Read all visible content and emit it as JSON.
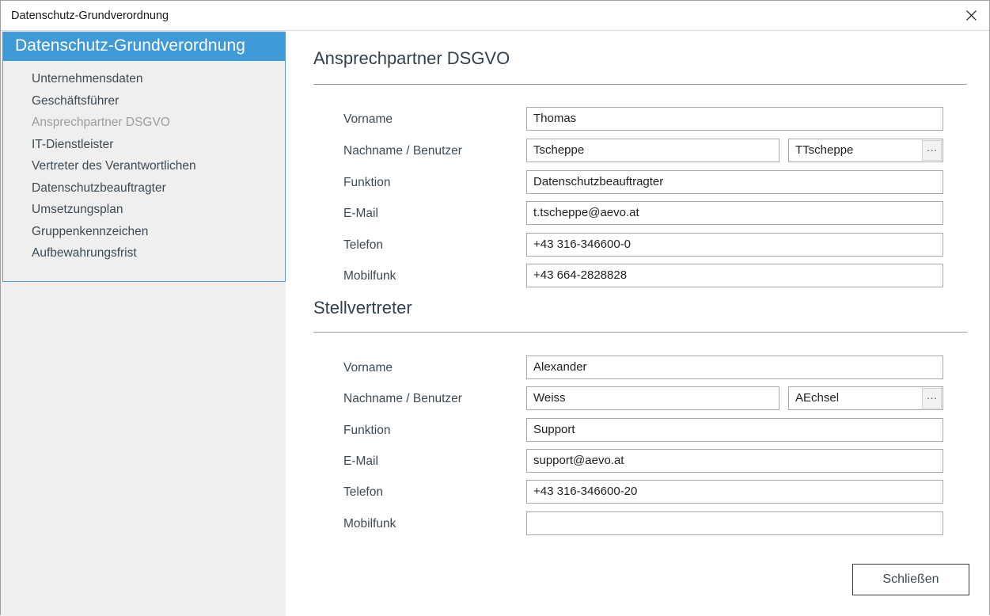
{
  "window": {
    "title": "Datenschutz-Grundverordnung",
    "close_icon": "close-icon"
  },
  "sidebar": {
    "header": "Datenschutz-Grundverordnung",
    "items": [
      {
        "label": "Unternehmensdaten",
        "active": false
      },
      {
        "label": "Geschäftsführer",
        "active": false
      },
      {
        "label": "Ansprechpartner DSGVO",
        "active": true
      },
      {
        "label": "IT-Dienstleister",
        "active": false
      },
      {
        "label": "Vertreter des Verantwortlichen",
        "active": false
      },
      {
        "label": "Datenschutzbeauftragter",
        "active": false
      },
      {
        "label": "Umsetzungsplan",
        "active": false
      },
      {
        "label": "Gruppenkennzeichen",
        "active": false
      },
      {
        "label": "Aufbewahrungsfrist",
        "active": false
      }
    ]
  },
  "sections": [
    {
      "title": "Ansprechpartner DSGVO",
      "fields": {
        "vorname": {
          "label": "Vorname",
          "value": "Thomas"
        },
        "nachname": {
          "label": "Nachname / Benutzer",
          "value": "Tscheppe"
        },
        "benutzer": {
          "value": "TTscheppe",
          "picker_label": "…"
        },
        "funktion": {
          "label": "Funktion",
          "value": "Datenschutzbeauftragter"
        },
        "email": {
          "label": "E-Mail",
          "value": "t.tscheppe@aevo.at"
        },
        "telefon": {
          "label": "Telefon",
          "value": "+43 316-346600-0"
        },
        "mobilfunk": {
          "label": "Mobilfunk",
          "value": "+43 664-2828828"
        }
      }
    },
    {
      "title": "Stellvertreter",
      "fields": {
        "vorname": {
          "label": "Vorname",
          "value": "Alexander"
        },
        "nachname": {
          "label": "Nachname / Benutzer",
          "value": "Weiss"
        },
        "benutzer": {
          "value": "AEchsel",
          "picker_label": "…"
        },
        "funktion": {
          "label": "Funktion",
          "value": "Support"
        },
        "email": {
          "label": "E-Mail",
          "value": "support@aevo.at"
        },
        "telefon": {
          "label": "Telefon",
          "value": "+43 316-346600-20"
        },
        "mobilfunk": {
          "label": "Mobilfunk",
          "value": ""
        }
      }
    }
  ],
  "footer": {
    "close_label": "Schließen"
  },
  "colors": {
    "accent": "#3f9ad7",
    "nav_border": "#5b9bd5",
    "panel_bg": "#efefef",
    "text": "#3d4a53",
    "muted_text": "#9d9d9d"
  }
}
